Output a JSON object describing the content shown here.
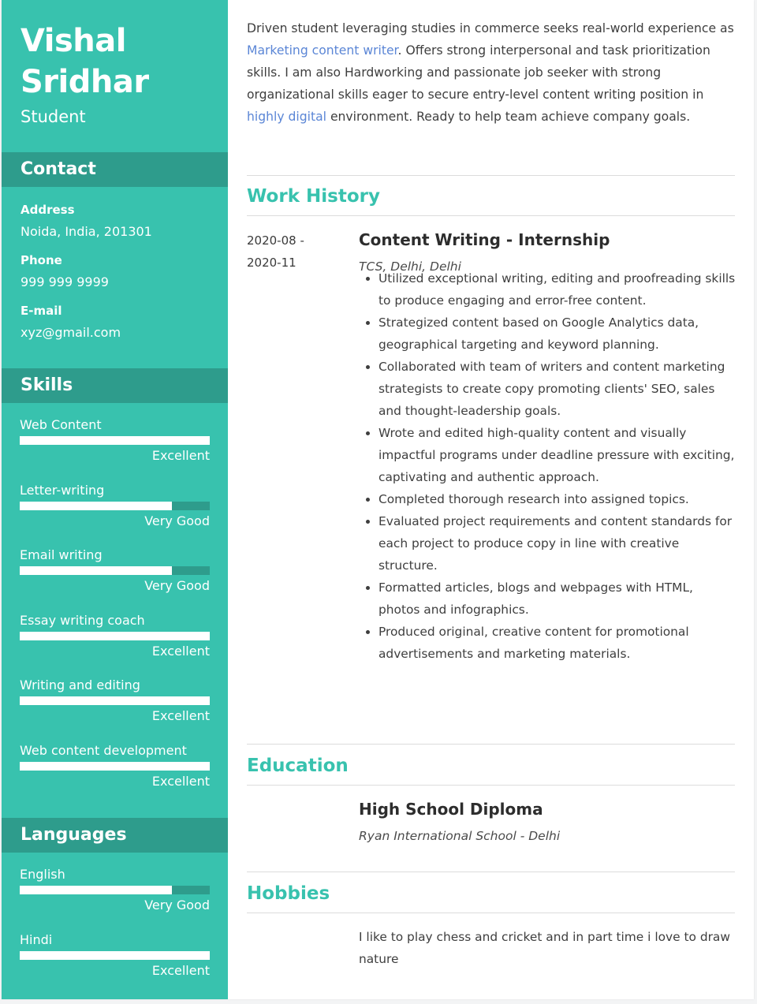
{
  "colors": {
    "accent": "#38c2ae",
    "accent_dark": "#2e9c8c",
    "link": "#5b86d6",
    "text": "#3e3e3e"
  },
  "profile": {
    "first_name": "Vishal",
    "last_name": "Sridhar",
    "title": "Student"
  },
  "contact": {
    "heading": "Contact",
    "items": [
      {
        "label": "Address",
        "value": "Noida, India, 201301"
      },
      {
        "label": "Phone",
        "value": "999 999 9999"
      },
      {
        "label": "E-mail",
        "value": "xyz@gmail.com"
      }
    ]
  },
  "skills": {
    "heading": "Skills",
    "items": [
      {
        "name": "Web Content",
        "level": "Excellent",
        "percent": 100
      },
      {
        "name": "Letter-writing",
        "level": "Very Good",
        "percent": 80
      },
      {
        "name": "Email writing",
        "level": "Very Good",
        "percent": 80
      },
      {
        "name": "Essay writing coach",
        "level": "Excellent",
        "percent": 100
      },
      {
        "name": "Writing and editing",
        "level": "Excellent",
        "percent": 100
      },
      {
        "name": "Web content development",
        "level": "Excellent",
        "percent": 100
      }
    ]
  },
  "languages": {
    "heading": "Languages",
    "items": [
      {
        "name": "English",
        "level": "Very Good",
        "percent": 80
      },
      {
        "name": "Hindi",
        "level": "Excellent",
        "percent": 100
      }
    ]
  },
  "summary": {
    "part1": "Driven student leveraging studies in commerce seeks real-world experience as ",
    "link1": "Marketing content writer",
    "part2": ". Offers strong interpersonal and task prioritization skills. I am also Hardworking and passionate job seeker with strong organizational skills eager to secure entry-level content writing position in ",
    "link2": "highly digital",
    "part3": " environment. Ready to help team achieve company goals."
  },
  "work_history": {
    "heading": "Work History",
    "entries": [
      {
        "date_start": "2020-08 -",
        "date_end": "2020-11",
        "title": "Content Writing - Internship",
        "company": "TCS, Delhi, Delhi",
        "bullets": [
          "Utilized exceptional writing, editing and proofreading skills to produce engaging and error-free content.",
          "Strategized content based on Google Analytics data, geographical targeting and keyword planning.",
          "Collaborated with team of writers and content marketing strategists to create copy promoting clients' SEO, sales and thought-leadership goals.",
          "Wrote and edited high-quality content and visually impactful programs under deadline pressure with exciting, captivating and authentic approach.",
          "Completed thorough research into assigned topics.",
          "Evaluated project requirements and content standards for each project to produce copy in line with creative structure.",
          "Formatted articles, blogs and webpages with HTML, photos and infographics.",
          "Produced original, creative content for promotional advertisements and marketing materials."
        ]
      }
    ]
  },
  "education": {
    "heading": "Education",
    "entries": [
      {
        "title": "High School Diploma",
        "school": "Ryan International School - Delhi"
      }
    ]
  },
  "hobbies": {
    "heading": "Hobbies",
    "text": "I like to play chess and cricket and in part time i love to draw nature"
  }
}
